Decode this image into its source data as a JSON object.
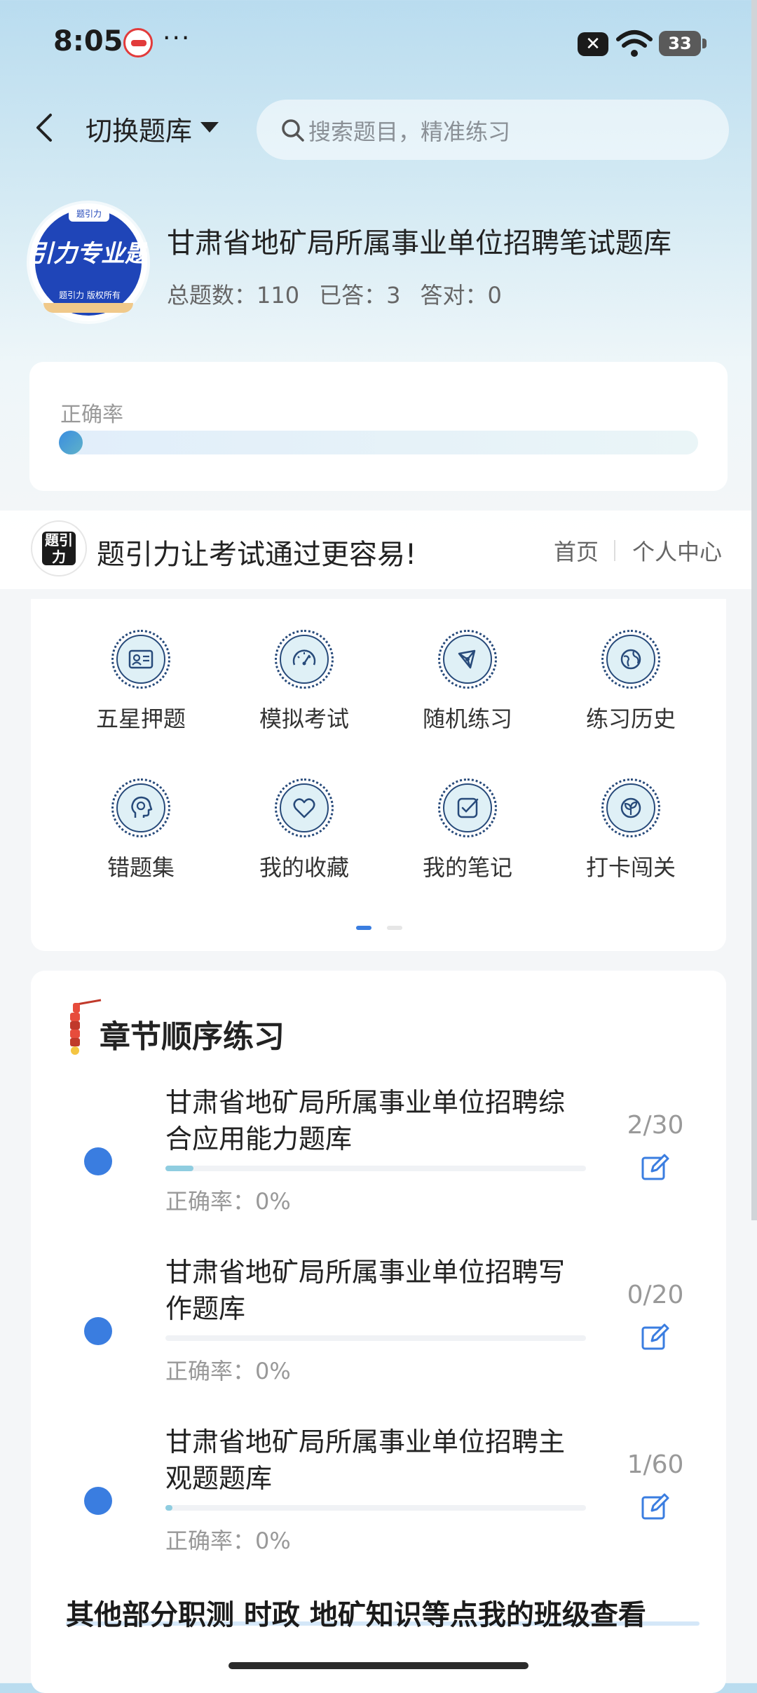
{
  "status_bar": {
    "time": "8:05",
    "dots": "···",
    "battery": "33"
  },
  "header": {
    "switch_label": "切换题库",
    "search_placeholder": "搜索题目，精准练习"
  },
  "bank": {
    "logo_text": "引力专业题",
    "logo_top": "题引力",
    "logo_sub": "题引力 版权所有",
    "title": "甘肃省地矿局所属事业单位招聘笔试题库",
    "stats": {
      "total": "总题数：110",
      "answered": "已答：3",
      "correct": "答对：0"
    }
  },
  "accuracy": {
    "label": "正确率",
    "value": 0
  },
  "promo": {
    "logo_text": "題引力",
    "text": "题引力让考试通过更容易!",
    "home": "首页",
    "personal_center": "个人中心"
  },
  "features": [
    {
      "label": "五星押题",
      "icon": "id-card-icon"
    },
    {
      "label": "模拟考试",
      "icon": "gauge-icon"
    },
    {
      "label": "随机练习",
      "icon": "network-icon"
    },
    {
      "label": "练习历史",
      "icon": "globe-icon"
    },
    {
      "label": "错题集",
      "icon": "head-icon"
    },
    {
      "label": "我的收藏",
      "icon": "heart-icon"
    },
    {
      "label": "我的笔记",
      "icon": "note-check-icon"
    },
    {
      "label": "打卡闯关",
      "icon": "sprout-icon"
    }
  ],
  "pager": {
    "pages": 2,
    "active": 1
  },
  "chapters": {
    "title": "章节顺序练习",
    "items": [
      {
        "name": "甘肃省地矿局所属事业单位招聘综合应用能力题库",
        "accuracy": "正确率：0%",
        "count": "2/30",
        "progress": 0.067
      },
      {
        "name": "甘肃省地矿局所属事业单位招聘写作题库",
        "accuracy": "正确率：0%",
        "count": "0/20",
        "progress": 0
      },
      {
        "name": "甘肃省地矿局所属事业单位招聘主观题题库",
        "accuracy": "正确率：0%",
        "count": "1/60",
        "progress": 0.017
      }
    ]
  },
  "footer_text": "其他部分职测 时政 地矿知识等点我的班级查看",
  "colors": {
    "accent": "#3a7de0",
    "icon_stroke": "#274a7a",
    "icon_fill": "#dff0f6"
  }
}
